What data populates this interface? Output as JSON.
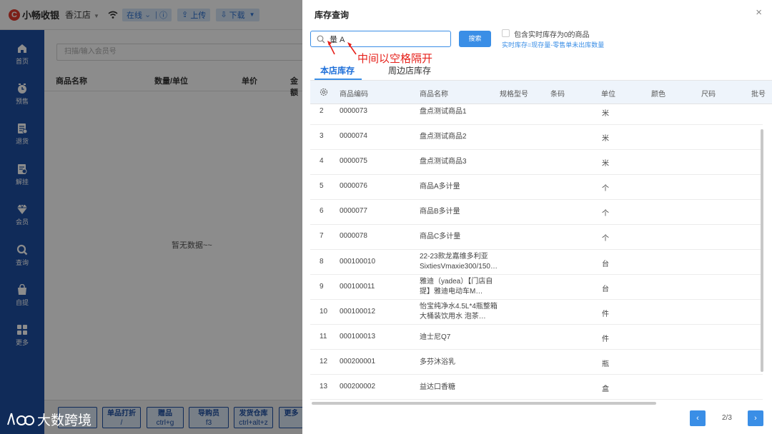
{
  "topbar": {
    "brand": "小畅收银",
    "store": "香江店",
    "status": "在线",
    "upload_label": "上传",
    "download_label": "下载"
  },
  "sidebar": {
    "items": [
      {
        "label": "首页",
        "icon": "home-icon"
      },
      {
        "label": "预售",
        "icon": "clock-icon"
      },
      {
        "label": "退货",
        "icon": "return-icon"
      },
      {
        "label": "解挂",
        "icon": "unhold-icon"
      },
      {
        "label": "会员",
        "icon": "diamond-icon"
      },
      {
        "label": "查询",
        "icon": "search-icon"
      },
      {
        "label": "自提",
        "icon": "bag-icon"
      },
      {
        "label": "更多",
        "icon": "grid-icon"
      }
    ]
  },
  "cart": {
    "member_placeholder": "扫描/输入会员号",
    "columns": [
      "商品名称",
      "数量/单位",
      "单价",
      "金额"
    ],
    "empty_text": "暂无数据~~"
  },
  "footer_buttons": [
    {
      "label": "单品打折",
      "shortcut": "/"
    },
    {
      "label": "赠品",
      "shortcut": "ctrl+g"
    },
    {
      "label": "导购员",
      "shortcut": "f3"
    },
    {
      "label": "发货仓库",
      "shortcut": "ctrl+alt+z"
    },
    {
      "label": "更多",
      "shortcut": ""
    }
  ],
  "dialog": {
    "title": "库存查询",
    "search_value": "量 A",
    "search_button": "搜索",
    "checkbox_label": "包含实时库存为0的商品",
    "hint": "实时库存=现存量-零售单未出库数量",
    "annotation": "中间以空格隔开",
    "tabs": [
      "本店库存",
      "周边店库存"
    ],
    "columns": [
      "商品编码",
      "商品名称",
      "规格型号",
      "条码",
      "单位",
      "颜色",
      "尺码",
      "批号"
    ],
    "rows": [
      {
        "idx": "2",
        "code": "0000073",
        "name": "盘点测试商品1",
        "unit": "米"
      },
      {
        "idx": "3",
        "code": "0000074",
        "name": "盘点测试商品2",
        "unit": "米"
      },
      {
        "idx": "4",
        "code": "0000075",
        "name": "盘点测试商品3",
        "unit": "米"
      },
      {
        "idx": "5",
        "code": "0000076",
        "name": "商品A多计量",
        "unit": "个"
      },
      {
        "idx": "6",
        "code": "0000077",
        "name": "商品B多计量",
        "unit": "个"
      },
      {
        "idx": "7",
        "code": "0000078",
        "name": "商品C多计量",
        "unit": "个"
      },
      {
        "idx": "8",
        "code": "000100010",
        "name": "22-23款龙嘉维多利亚SixtiesVmaxie300/150…",
        "unit": "台"
      },
      {
        "idx": "9",
        "code": "000100011",
        "name": "雅迪（yadea）【门店自提】雅迪电动车M…",
        "unit": "台"
      },
      {
        "idx": "10",
        "code": "000100012",
        "name": "怡宝纯净水4.5L*4瓶整箱大桶装饮用水 泡茶…",
        "unit": "件"
      },
      {
        "idx": "11",
        "code": "000100013",
        "name": "迪士尼Q7",
        "unit": "件"
      },
      {
        "idx": "12",
        "code": "000200001",
        "name": "多芬沐浴乳",
        "unit": "瓶"
      },
      {
        "idx": "13",
        "code": "000200002",
        "name": "益达口香糖",
        "unit": "盒"
      }
    ],
    "pager": "2/3"
  },
  "watermark": "大数跨境",
  "colors": {
    "sidebar": "#1e4fa3",
    "accent": "#3a8ee6",
    "annotation": "#e6211b"
  }
}
